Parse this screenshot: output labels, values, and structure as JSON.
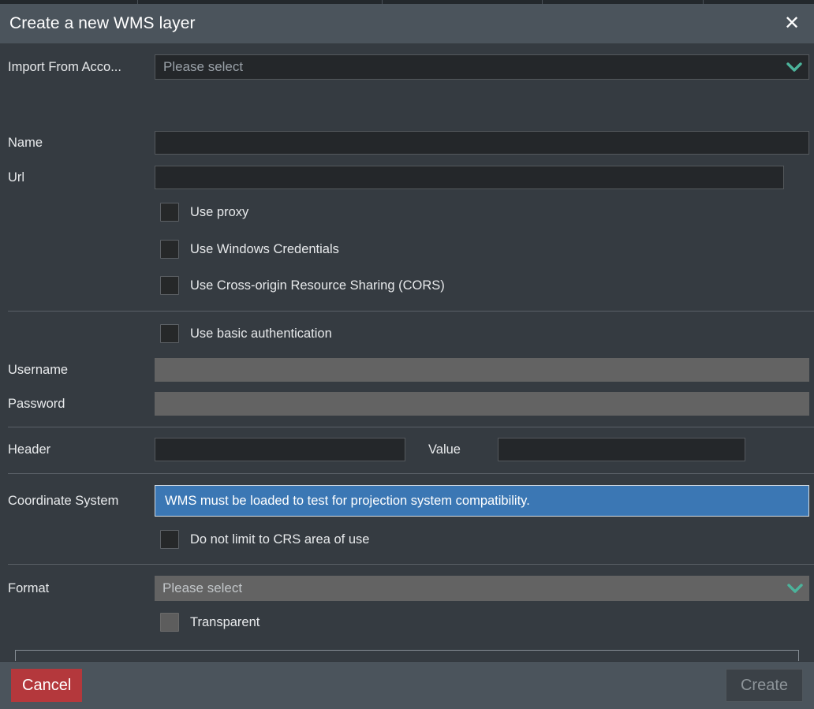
{
  "window": {
    "title": "Create a new WMS layer",
    "close_icon": "close-icon"
  },
  "colors": {
    "dialog_bg": "#353b41",
    "titlebar_bg": "#4b545c",
    "field_bg": "#24272a",
    "field_border": "#55595d",
    "disabled_bg": "#636363",
    "accent_chevron": "#4cb39b",
    "banner_bg": "#3b77b4",
    "cancel_red": "#b4383c",
    "text_primary": "#e8eaec",
    "text_placeholder": "#9aa1a8"
  },
  "form": {
    "import_from_account": {
      "label": "Import From Acco...",
      "placeholder": "Please select",
      "value": "",
      "chevron_icon": "chevron-down-icon",
      "disabled": false
    },
    "name": {
      "label": "Name",
      "value": "",
      "placeholder": ""
    },
    "url": {
      "label": "Url",
      "value": "",
      "placeholder": ""
    },
    "use_proxy": {
      "label": "Use proxy",
      "checked": false,
      "disabled": false
    },
    "use_windows_credentials": {
      "label": "Use Windows Credentials",
      "checked": false,
      "disabled": false
    },
    "use_cors": {
      "label": "Use Cross-origin Resource Sharing (CORS)",
      "checked": false,
      "disabled": false
    },
    "use_basic_auth": {
      "label": "Use basic authentication",
      "checked": false,
      "disabled": false
    },
    "username": {
      "label": "Username",
      "value": "",
      "placeholder": "",
      "disabled": true
    },
    "password": {
      "label": "Password",
      "value": "",
      "placeholder": "",
      "disabled": true
    },
    "header": {
      "label": "Header",
      "value": "",
      "placeholder": ""
    },
    "header_value": {
      "label": "Value",
      "value": "",
      "placeholder": ""
    },
    "coordinate_system": {
      "label": "Coordinate System",
      "banner_text": "WMS must be loaded to test for projection system compatibility."
    },
    "do_not_limit_crs": {
      "label": "Do not limit to CRS area of use",
      "checked": false,
      "disabled": false
    },
    "format": {
      "label": "Format",
      "placeholder": "Please select",
      "value": "",
      "chevron_icon": "chevron-down-icon",
      "disabled": true
    },
    "transparent": {
      "label": "Transparent",
      "checked": false,
      "disabled": true
    },
    "layer_list": {
      "items": []
    }
  },
  "footer": {
    "cancel_label": "Cancel",
    "create_label": "Create",
    "create_disabled": true
  }
}
